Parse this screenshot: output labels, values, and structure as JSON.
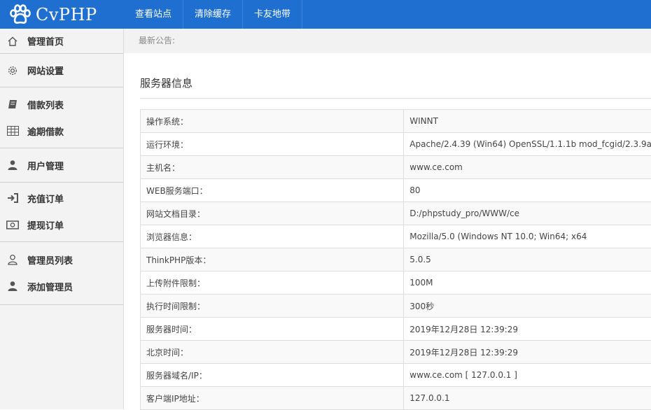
{
  "brand": {
    "name": "CvPHP",
    "icon": "paw-icon"
  },
  "topnav": [
    {
      "label": "查看站点"
    },
    {
      "label": "清除缓存"
    },
    {
      "label": "卡友地带"
    }
  ],
  "sidebar": {
    "items": [
      {
        "label": "管理首页",
        "icon": "home-icon"
      },
      {
        "label": "网站设置",
        "icon": "gear-icon"
      },
      {
        "label": "借款列表",
        "icon": "book-icon"
      },
      {
        "label": "逾期借款",
        "icon": "table-icon"
      },
      {
        "label": "用户管理",
        "icon": "user-icon"
      },
      {
        "label": "充值订单",
        "icon": "sign-in-icon"
      },
      {
        "label": "提现订单",
        "icon": "money-icon"
      },
      {
        "label": "管理员列表",
        "icon": "user-outline-icon"
      },
      {
        "label": "添加管理员",
        "icon": "user-icon"
      }
    ]
  },
  "notice": {
    "label": "最新公告:"
  },
  "server_info": {
    "title": "服务器信息",
    "rows": [
      {
        "key": "操作系统：",
        "value": "WINNT"
      },
      {
        "key": "运行环境：",
        "value": "Apache/2.4.39 (Win64) OpenSSL/1.1.1b mod_fcgid/2.3.9a"
      },
      {
        "key": "主机名：",
        "value": "www.ce.com"
      },
      {
        "key": "WEB服务端口：",
        "value": "80"
      },
      {
        "key": "网站文档目录：",
        "value": "D:/phpstudy_pro/WWW/ce"
      },
      {
        "key": "浏览器信息：",
        "value": "Mozilla/5.0 (Windows NT 10.0; Win64; x64"
      },
      {
        "key": "ThinkPHP版本：",
        "value": "5.0.5"
      },
      {
        "key": "上传附件限制：",
        "value": "100M"
      },
      {
        "key": "执行时间限制：",
        "value": "300秒"
      },
      {
        "key": "服务器时间：",
        "value": "2019年12月28日 12:39:29"
      },
      {
        "key": "北京时间：",
        "value": "2019年12月28日 12:39:29"
      },
      {
        "key": "服务器域名/IP：",
        "value": "www.ce.com [ 127.0.0.1 ]"
      },
      {
        "key": "客户端IP地址：",
        "value": "127.0.0.1"
      }
    ]
  },
  "colors": {
    "topbar": "#1f6fd1",
    "sidebar": "#f3f3f3"
  }
}
